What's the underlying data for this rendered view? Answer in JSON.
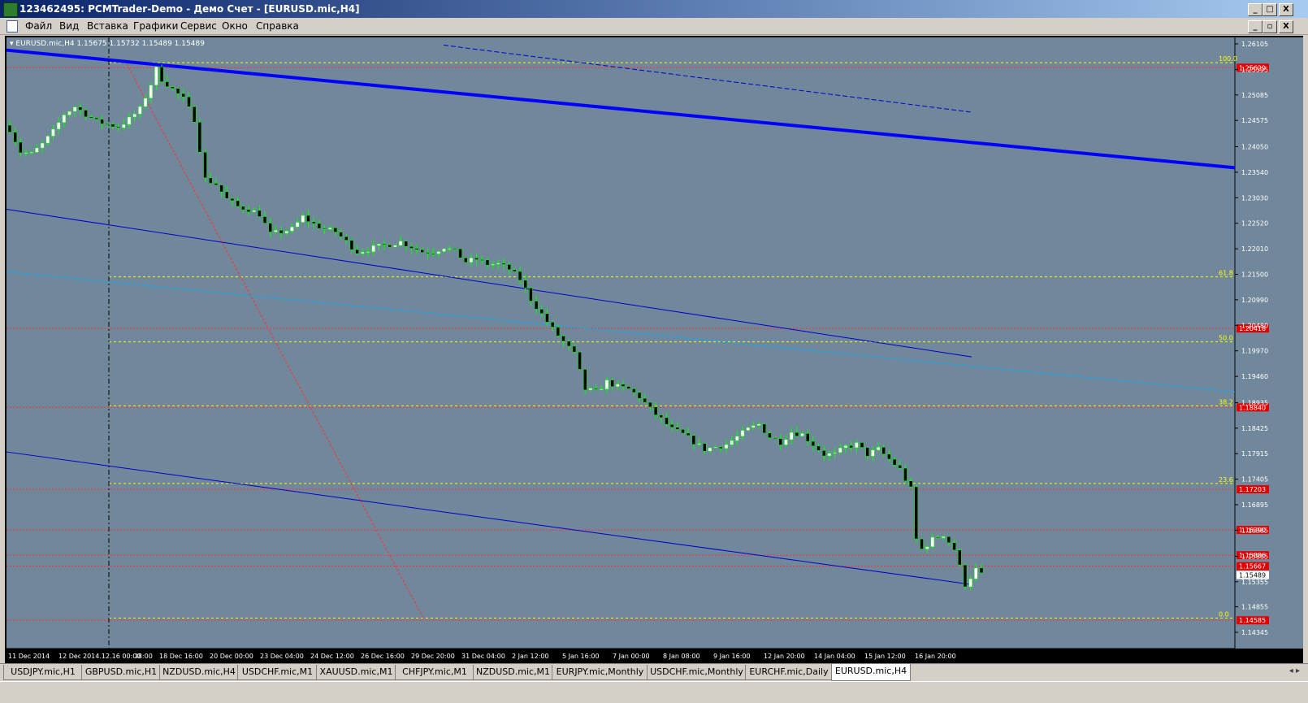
{
  "window": {
    "title": "123462495: PCMTrader-Demo - Демо Счет - [EURUSD.mic,H4]",
    "controls": [
      "_",
      "□",
      "X"
    ],
    "mdi_controls": [
      "_",
      "▫",
      "X"
    ]
  },
  "menu": [
    "Файл",
    "Вид",
    "Вставка",
    "Графики",
    "Сервис",
    "Окно",
    "Справка"
  ],
  "chart": {
    "header": "▾ EURUSD.mic,H4  1.15675 1.15732 1.15489 1.15489",
    "ylim": [
      1.14345,
      1.26105
    ],
    "price_axis": [
      "1.26105",
      "1.25595",
      "1.25085",
      "1.24575",
      "1.24050",
      "1.23540",
      "1.23030",
      "1.22520",
      "1.22010",
      "1.21500",
      "1.20990",
      "1.20480",
      "1.19970",
      "1.19460",
      "1.18935",
      "1.18425",
      "1.17915",
      "1.17405",
      "1.16895",
      "1.16385",
      "1.15865",
      "1.15355",
      "1.14855",
      "1.14345"
    ],
    "time_axis": [
      "11 Dec 2014",
      "12 Dec",
      "17 Dec 08:00",
      "18 Dec 16:00",
      "20 Dec 00:00",
      "23 Dec 04:00",
      "24 Dec 12:00",
      "26 Dec 16:00",
      "29 Dec 20:00",
      "31 Dec 04:00",
      "2 Jan 12:00",
      "5 Jan 16:00",
      "7 Jan 00:00",
      "8 Jan 08:00",
      "9 Jan 16:00",
      "12 Jan 20:00",
      "14 Jan 04:00",
      "15 Jan 12:00",
      "16 Jan 20:00"
    ],
    "crosshair_time": "2014.12.16 00:00",
    "current_price": "1.15489",
    "hlines": [
      {
        "price": 1.25629,
        "label": "1.25629"
      },
      {
        "price": 1.20418,
        "label": "1.20418"
      },
      {
        "price": 1.1884,
        "label": "1.18840"
      },
      {
        "price": 1.17203,
        "label": "1.17203"
      },
      {
        "price": 1.1639,
        "label": "1.16390"
      },
      {
        "price": 1.15886,
        "label": "1.15886"
      },
      {
        "price": 1.15667,
        "label": "1.15667"
      },
      {
        "price": 1.14585,
        "label": "1.14585"
      }
    ],
    "fib_levels": [
      {
        "pct": "100.0",
        "price": 1.2573
      },
      {
        "pct": "61.8",
        "price": 1.2145
      },
      {
        "pct": "50.0",
        "price": 1.2015
      },
      {
        "pct": "38.2",
        "price": 1.1887
      },
      {
        "pct": "23.6",
        "price": 1.1732
      },
      {
        "pct": "0.0",
        "price": 1.1463
      }
    ],
    "colors": {
      "background": "#71879b",
      "frame": "#000000",
      "bull_candle": "#ffffff",
      "bear_candle": "#000000",
      "wick": "#00ff00",
      "axis_text": "#ffffff",
      "hline": "#ff3030",
      "fib": "#ffff00",
      "trend_thick": "#0000ff",
      "trend_thin": "#0000cc",
      "trend_cyan": "#00b0ff",
      "diag": "#ff3030"
    }
  },
  "chart_data": {
    "type": "candlestick",
    "symbol": "EURUSD.mic",
    "timeframe": "H4",
    "ylim": [
      1.14345,
      1.26105
    ],
    "last_ohlc": [
      1.15675,
      1.15732,
      1.15489,
      1.15489
    ],
    "close_path": [
      [
        0,
        1.244
      ],
      [
        2,
        1.2395
      ],
      [
        4,
        1.239
      ],
      [
        6,
        1.241
      ],
      [
        8,
        1.2435
      ],
      [
        10,
        1.247
      ],
      [
        12,
        1.2485
      ],
      [
        14,
        1.247
      ],
      [
        16,
        1.2455
      ],
      [
        18,
        1.245
      ],
      [
        20,
        1.2445
      ],
      [
        22,
        1.246
      ],
      [
        24,
        1.248
      ],
      [
        26,
        1.253
      ],
      [
        27,
        1.256
      ],
      [
        28,
        1.254
      ],
      [
        30,
        1.252
      ],
      [
        32,
        1.25
      ],
      [
        34,
        1.246
      ],
      [
        35,
        1.24
      ],
      [
        36,
        1.234
      ],
      [
        38,
        1.233
      ],
      [
        40,
        1.23
      ],
      [
        42,
        1.2285
      ],
      [
        44,
        1.228
      ],
      [
        46,
        1.227
      ],
      [
        48,
        1.223
      ],
      [
        50,
        1.2235
      ],
      [
        52,
        1.224
      ],
      [
        54,
        1.2265
      ],
      [
        56,
        1.225
      ],
      [
        58,
        1.224
      ],
      [
        60,
        1.2235
      ],
      [
        62,
        1.2215
      ],
      [
        64,
        1.2195
      ],
      [
        66,
        1.22
      ],
      [
        68,
        1.2205
      ],
      [
        70,
        1.221
      ],
      [
        72,
        1.2215
      ],
      [
        74,
        1.2205
      ],
      [
        76,
        1.2195
      ],
      [
        78,
        1.2195
      ],
      [
        80,
        1.2205
      ],
      [
        82,
        1.2195
      ],
      [
        84,
        1.2175
      ],
      [
        86,
        1.218
      ],
      [
        88,
        1.217
      ],
      [
        90,
        1.217
      ],
      [
        92,
        1.216
      ],
      [
        94,
        1.214
      ],
      [
        96,
        1.21
      ],
      [
        98,
        1.207
      ],
      [
        100,
        1.204
      ],
      [
        102,
        1.2015
      ],
      [
        104,
        1.199
      ],
      [
        106,
        1.192
      ],
      [
        108,
        1.1915
      ],
      [
        110,
        1.1935
      ],
      [
        112,
        1.1925
      ],
      [
        114,
        1.192
      ],
      [
        116,
        1.1905
      ],
      [
        118,
        1.188
      ],
      [
        120,
        1.186
      ],
      [
        122,
        1.184
      ],
      [
        124,
        1.183
      ],
      [
        126,
        1.1815
      ],
      [
        128,
        1.18
      ],
      [
        130,
        1.1805
      ],
      [
        132,
        1.181
      ],
      [
        134,
        1.1825
      ],
      [
        136,
        1.184
      ],
      [
        138,
        1.185
      ],
      [
        140,
        1.1825
      ],
      [
        142,
        1.1815
      ],
      [
        144,
        1.1835
      ],
      [
        146,
        1.183
      ],
      [
        148,
        1.181
      ],
      [
        150,
        1.179
      ],
      [
        152,
        1.179
      ],
      [
        154,
        1.1805
      ],
      [
        156,
        1.181
      ],
      [
        158,
        1.179
      ],
      [
        160,
        1.18
      ],
      [
        162,
        1.178
      ],
      [
        164,
        1.176
      ],
      [
        166,
        1.172
      ],
      [
        167,
        1.162
      ],
      [
        168,
        1.16
      ],
      [
        170,
        1.162
      ],
      [
        172,
        1.163
      ],
      [
        174,
        1.16
      ],
      [
        176,
        1.153
      ],
      [
        178,
        1.156
      ],
      [
        179,
        1.1549
      ]
    ]
  },
  "tabs": [
    "USDJPY.mic,H1",
    "GBPUSD.mic,H1",
    "NZDUSD.mic,H4",
    "USDCHF.mic,M1",
    "XAUUSD.mic,M1",
    "CHFJPY.mic,M1",
    "NZDUSD.mic,M1",
    "EURJPY.mic,Monthly",
    "USDCHF.mic,Monthly",
    "EURCHF.mic,Daily",
    "EURUSD.mic,H4"
  ],
  "active_tab": "EURUSD.mic,H4"
}
